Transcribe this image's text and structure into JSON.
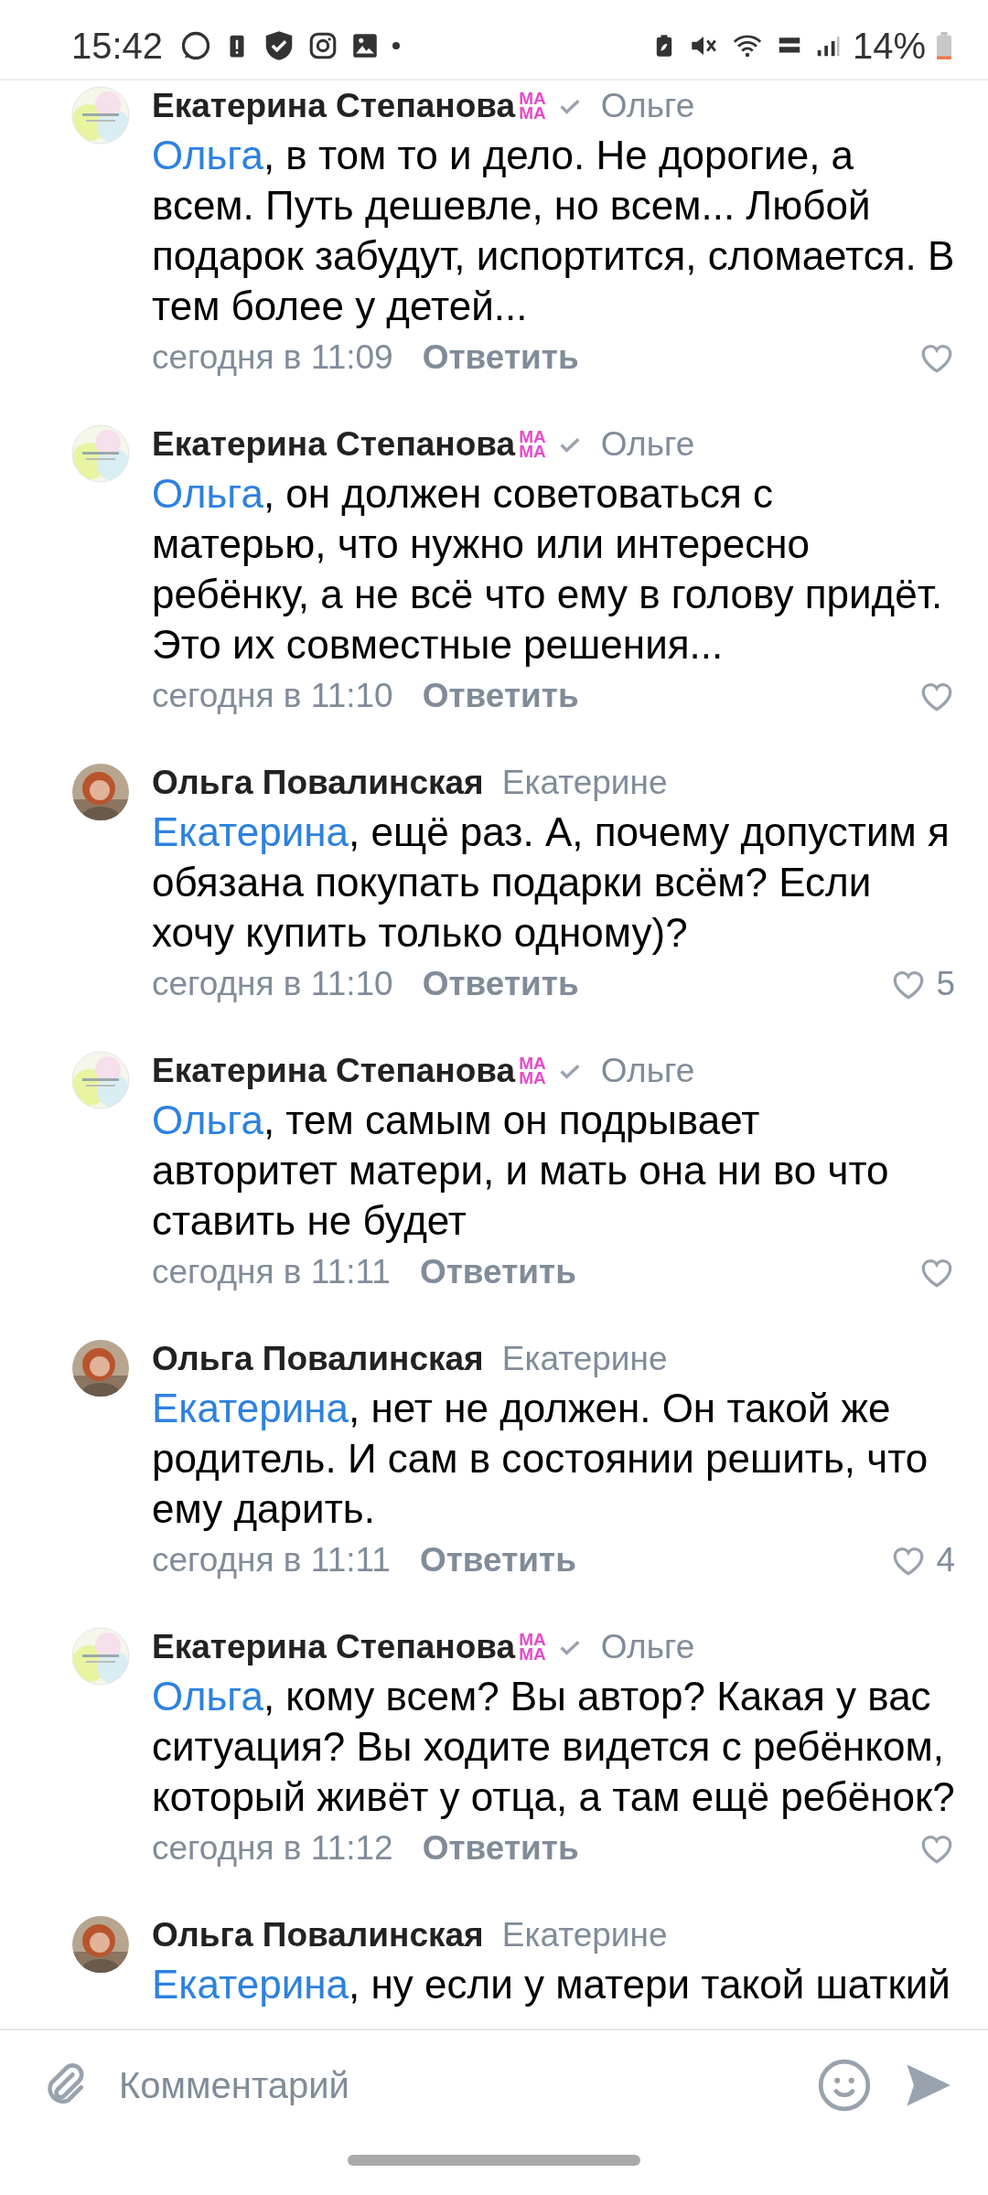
{
  "status_bar": {
    "time": "15:42",
    "battery": "14%"
  },
  "comments": [
    {
      "avatar": {
        "kind": "logo"
      },
      "author": "Екатерина Степанова",
      "badge_lines": [
        "МА",
        "МА"
      ],
      "verified": true,
      "reply_to": "Ольге",
      "mention": "Ольга",
      "text": ", в том то и дело. Не дорогие, а всем. Путь дешевле, но всем... Любой подарок забудут, испортится, сломается. В тем более у детей...",
      "date": "сегодня в 11:09",
      "reply": "Ответить"
    },
    {
      "avatar": {
        "kind": "logo"
      },
      "author": "Екатерина Степанова",
      "badge_lines": [
        "МА",
        "МА"
      ],
      "verified": true,
      "reply_to": "Ольге",
      "mention": "Ольга",
      "text": ", он должен советоваться с матерью, что нужно или интересно ребёнку, а не всё что ему в голову придёт. Это их совместные решения...",
      "date": "сегодня в 11:10",
      "reply": "Ответить"
    },
    {
      "avatar": {
        "kind": "person"
      },
      "author": "Ольга Повалинская",
      "verified": false,
      "reply_to": "Екатерине",
      "mention": "Екатерина",
      "text": ", ещё раз. А, почему допустим я обязана покупать подарки всём? Если хочу купить только одному)?",
      "date": "сегодня в 11:10",
      "reply": "Ответить",
      "likes": "5"
    },
    {
      "avatar": {
        "kind": "logo"
      },
      "author": "Екатерина Степанова",
      "badge_lines": [
        "МА",
        "МА"
      ],
      "verified": true,
      "reply_to": "Ольге",
      "mention": "Ольга",
      "text": ", тем самым он подрывает авторитет матери, и мать она ни во что ставить не будет",
      "date": "сегодня в 11:11",
      "reply": "Ответить"
    },
    {
      "avatar": {
        "kind": "person"
      },
      "author": "Ольга Повалинская",
      "verified": false,
      "reply_to": "Екатерине",
      "mention": "Екатерина",
      "text": ", нет не должен. Он такой же родитель. И сам в состоянии решить, что ему дарить.",
      "date": "сегодня в 11:11",
      "reply": "Ответить",
      "likes": "4"
    },
    {
      "avatar": {
        "kind": "logo"
      },
      "author": "Екатерина Степанова",
      "badge_lines": [
        "МА",
        "МА"
      ],
      "verified": true,
      "reply_to": "Ольге",
      "mention": "Ольга",
      "text": ", кому всем? Вы автор? Какая у вас ситуация? Вы ходите видется с ребёнком, который живёт у отца, а там ещё ребёнок?",
      "date": "сегодня в 11:12",
      "reply": "Ответить"
    },
    {
      "avatar": {
        "kind": "person"
      },
      "author": "Ольга Повалинская",
      "verified": false,
      "reply_to": "Екатерине",
      "mention": "Екатерина",
      "text": ", ну если у матери такой шаткий"
    }
  ],
  "composer": {
    "placeholder": "Комментарий"
  }
}
